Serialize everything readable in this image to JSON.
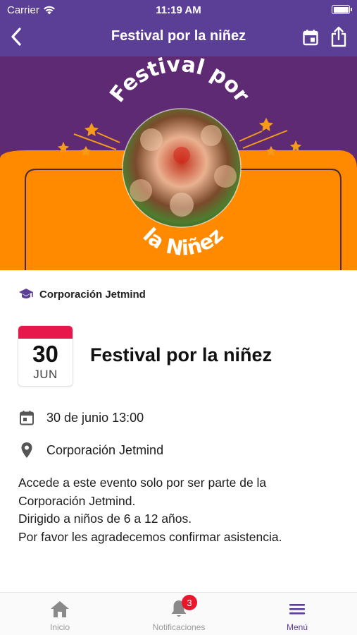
{
  "status_bar": {
    "carrier": "Carrier",
    "time": "11:19 AM"
  },
  "nav": {
    "title": "Festival por la niñez",
    "back_icon": "chevron-left-icon",
    "calendar_icon": "calendar-icon",
    "share_icon": "share-icon"
  },
  "banner": {
    "title_top": "Festival por",
    "title_bottom": "la Niñez",
    "colors": {
      "background": "#5e2a73",
      "orange": "#ff8a00",
      "outline": "#4a2a3a",
      "star": "#f59a1a"
    }
  },
  "event": {
    "organizer": "Corporación Jetmind",
    "organizer_icon": "graduation-cap-icon",
    "day": "30",
    "month": "JUN",
    "title": "Festival por la niñez",
    "datetime": "30 de junio 13:00",
    "location": "Corporación Jetmind",
    "description": [
      "Accede a este evento solo por ser parte de la",
      "Corporación Jetmind.",
      "Dirigido a niños de 6 a 12 años.",
      "Por favor les agradecemos confirmar asistencia."
    ]
  },
  "tabbar": {
    "tabs": [
      {
        "label": "Inicio",
        "icon": "home-icon",
        "active": false
      },
      {
        "label": "Notificaciones",
        "icon": "bell-icon",
        "active": false,
        "badge": "3"
      },
      {
        "label": "Menú",
        "icon": "menu-icon",
        "active": true
      }
    ]
  },
  "colors": {
    "header": "#5b3f97",
    "accent": "#5b3f97",
    "date_badge": "#e8174b",
    "notification_badge": "#e8172b"
  }
}
